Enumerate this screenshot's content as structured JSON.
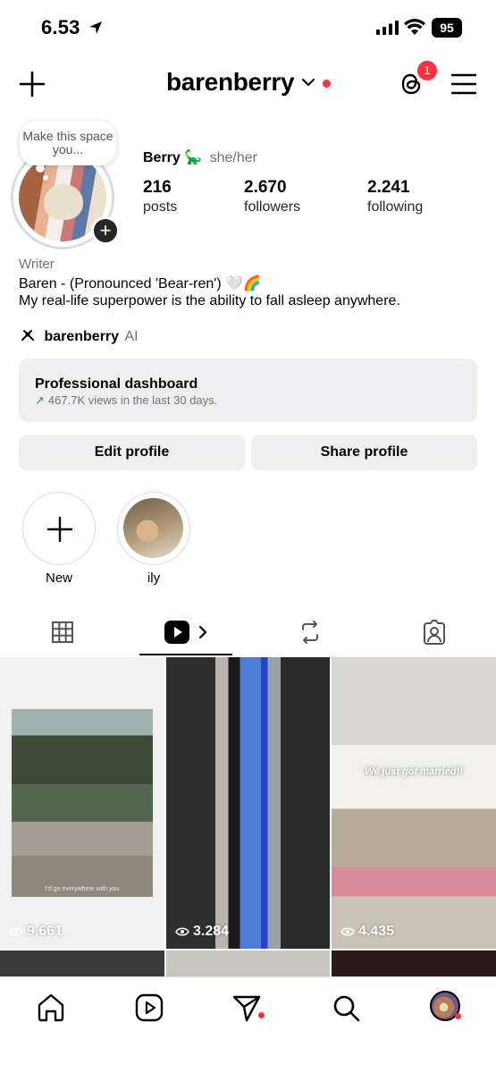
{
  "status_bar": {
    "time": "6.53",
    "battery": "95"
  },
  "header": {
    "username": "barenberry",
    "threads_badge": "1"
  },
  "note": {
    "text": "Make this space you..."
  },
  "profile": {
    "name": "Berry 🦕",
    "pronouns": "she/her",
    "stats": [
      {
        "value": "216",
        "label": "posts"
      },
      {
        "value": "2.670",
        "label": "followers"
      },
      {
        "value": "2.241",
        "label": "following"
      }
    ],
    "category": "Writer",
    "bio_line1": "Baren - (Pronounced 'Bear-ren') 🤍🌈",
    "bio_line2": "My real-life superpower is the ability to fall asleep anywhere.",
    "threads_handle": "barenberry",
    "threads_suffix": "AI"
  },
  "dashboard": {
    "title": "Professional dashboard",
    "subtitle": "467.7K views in the last 30 days."
  },
  "actions": {
    "edit": "Edit profile",
    "share": "Share profile"
  },
  "highlights": [
    {
      "label": "New"
    },
    {
      "label": "ily"
    }
  ],
  "posts": [
    {
      "views": "9.661",
      "caption": "I'd go everywhere with you"
    },
    {
      "views": "3.284"
    },
    {
      "views": "4.435",
      "caption": "We just got married!!"
    }
  ],
  "colors": {
    "accent_red": "#ff3040",
    "surface": "#efeff1",
    "trend_green": "#1f9b4a"
  },
  "icons": [
    "plus-icon",
    "chevron-down-icon",
    "threads-icon",
    "menu-icon",
    "grid-icon",
    "reels-icon",
    "reposts-icon",
    "tagged-icon",
    "home-icon",
    "send-icon",
    "search-icon"
  ]
}
